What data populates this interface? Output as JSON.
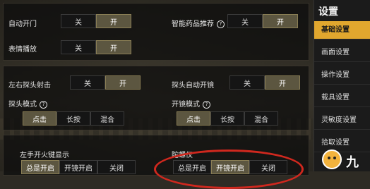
{
  "panel_top": {
    "auto_door": {
      "label": "自动开门",
      "off": "关",
      "on": "开",
      "selected": "on"
    },
    "smart_meds": {
      "label": "智能药品推荐",
      "help": "?",
      "off": "关",
      "on": "开",
      "selected": "on"
    },
    "emote": {
      "label": "表情播放",
      "off": "关",
      "on": "开",
      "selected": "on"
    }
  },
  "panel_mid": {
    "peek_fire": {
      "label": "左右探头射击",
      "off": "关",
      "on": "开",
      "selected": "on"
    },
    "peek_auto_scope": {
      "label": "探头自动开镜",
      "off": "关",
      "on": "开",
      "selected": "on"
    },
    "peek_mode": {
      "label": "探头模式",
      "help": "?",
      "options": [
        "点击",
        "长按",
        "混合"
      ],
      "selected": 0
    },
    "scope_mode": {
      "label": "开镜模式",
      "help": "?",
      "options": [
        "点击",
        "长按",
        "混合"
      ],
      "selected": 0
    }
  },
  "panel_bottom": {
    "left_fire": {
      "label": "左手开火键显示",
      "options": [
        "总是开启",
        "开镜开启",
        "关闭"
      ],
      "selected": 0
    },
    "gyro": {
      "label": "陀螺仪",
      "options": [
        "总是开启",
        "开镜开启",
        "关闭"
      ],
      "selected": 1
    }
  },
  "sidebar": {
    "title": "设置",
    "items": [
      {
        "label": "基础设置",
        "active": true
      },
      {
        "label": "画面设置",
        "active": false
      },
      {
        "label": "操作设置",
        "active": false
      },
      {
        "label": "载具设置",
        "active": false
      },
      {
        "label": "灵敏度设置",
        "active": false
      },
      {
        "label": "拾取设置",
        "active": false
      }
    ]
  },
  "watermark": "九",
  "colors": {
    "accent": "#e1a72e",
    "selected": "#5c5640",
    "highlight_circle": "#d0281e"
  }
}
